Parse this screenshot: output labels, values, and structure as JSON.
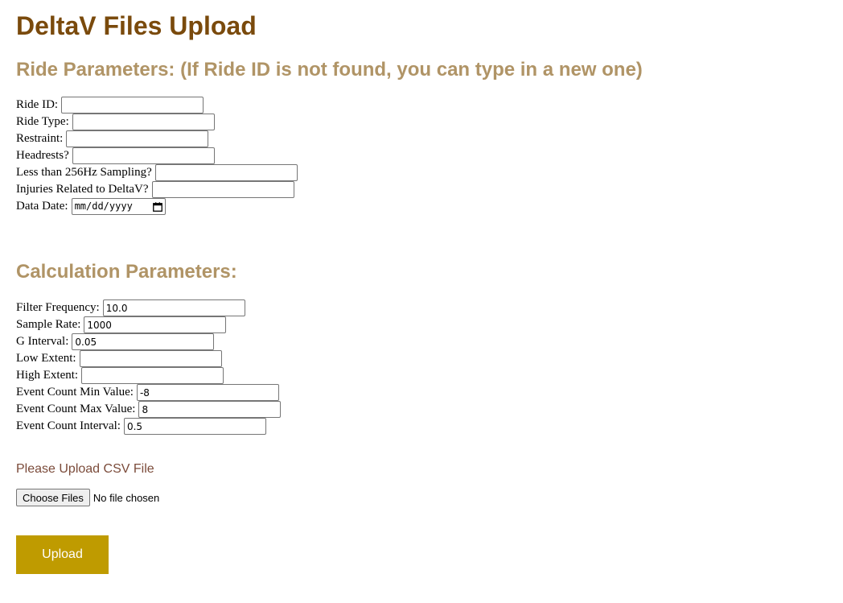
{
  "page": {
    "title": "DeltaV Files Upload"
  },
  "ride_section": {
    "heading": "Ride Parameters: (If Ride ID is not found, you can type in a new one)",
    "ride_id": {
      "label": "Ride ID:",
      "value": ""
    },
    "ride_type": {
      "label": "Ride Type:",
      "value": ""
    },
    "restraint": {
      "label": "Restraint:",
      "value": ""
    },
    "headrests": {
      "label": "Headrests?",
      "value": ""
    },
    "sampling": {
      "label": "Less than 256Hz Sampling?",
      "value": ""
    },
    "injuries": {
      "label": "Injuries Related to DeltaV?",
      "value": ""
    },
    "data_date": {
      "label": "Data Date:",
      "placeholder": "mm/dd/yyyy",
      "icon": "calendar-icon"
    }
  },
  "calc_section": {
    "heading": "Calculation Parameters:",
    "filter_frequency": {
      "label": "Filter Frequency:",
      "value": "10.0"
    },
    "sample_rate": {
      "label": "Sample Rate:",
      "value": "1000"
    },
    "g_interval": {
      "label": "G Interval:",
      "value": "0.05"
    },
    "low_extent": {
      "label": "Low Extent:",
      "value": ""
    },
    "high_extent": {
      "label": "High Extent:",
      "value": ""
    },
    "event_min": {
      "label": "Event Count Min Value:",
      "value": "-8"
    },
    "event_max": {
      "label": "Event Count Max Value:",
      "value": "8"
    },
    "event_interval": {
      "label": "Event Count Interval:",
      "value": "0.5"
    }
  },
  "upload_section": {
    "label": "Please Upload CSV File",
    "choose_button": "Choose Files",
    "file_status": "No file chosen",
    "upload_button": "Upload"
  },
  "colors": {
    "title": "#7a4a0c",
    "section_heading": "#b09466",
    "upload_label": "#7b4b3a",
    "upload_button": "#bf9b00"
  }
}
